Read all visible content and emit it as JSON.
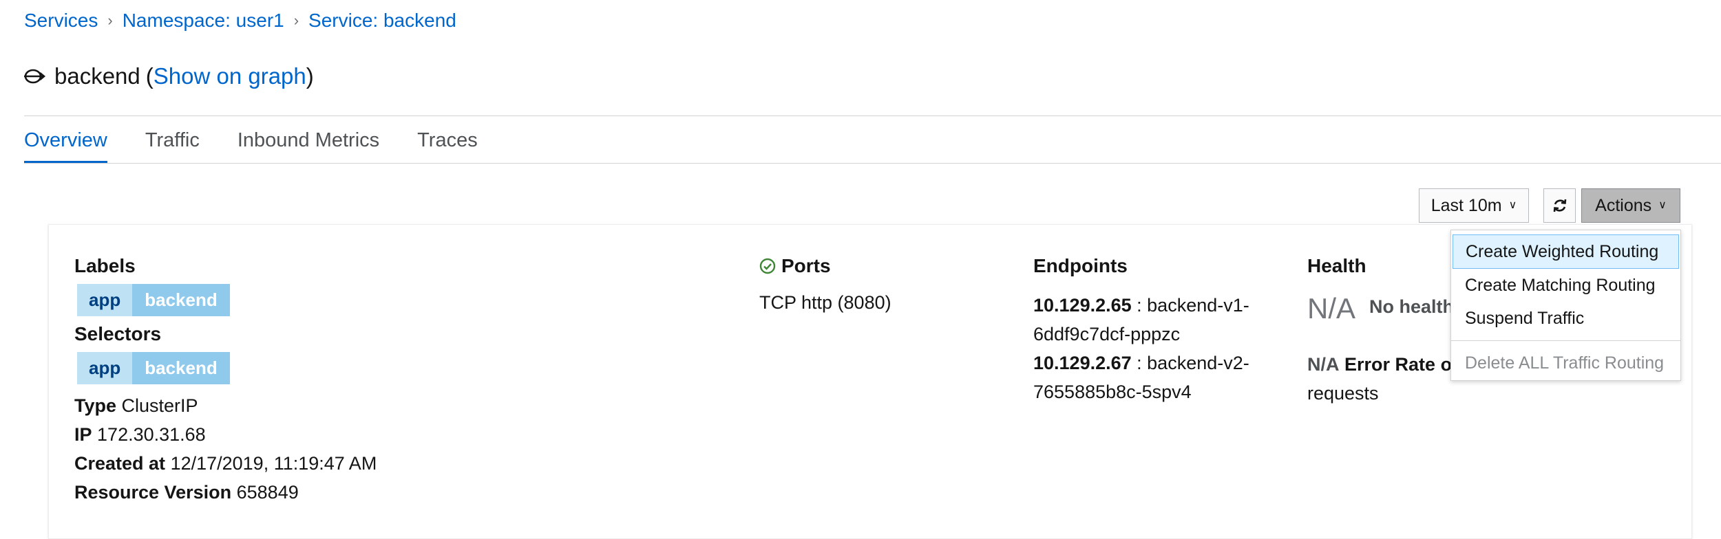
{
  "breadcrumb": [
    {
      "label": "Services"
    },
    {
      "label": "Namespace: user1"
    },
    {
      "label": "Service: backend"
    }
  ],
  "title": {
    "name": "backend",
    "open_paren": "(",
    "link": "Show on graph",
    "close_paren": ")"
  },
  "tabs": [
    {
      "label": "Overview",
      "active": true
    },
    {
      "label": "Traffic"
    },
    {
      "label": "Inbound Metrics"
    },
    {
      "label": "Traces"
    }
  ],
  "toolbar": {
    "time_range": "Last 10m",
    "refresh_icon": "refresh-icon",
    "actions_label": "Actions"
  },
  "actions_menu": [
    {
      "label": "Create Weighted Routing"
    },
    {
      "label": "Create Matching Routing"
    },
    {
      "label": "Suspend Traffic"
    },
    {
      "label": "Delete ALL Traffic Routing"
    }
  ],
  "details": {
    "labels_heading": "Labels",
    "labels": [
      {
        "key": "app",
        "value": "backend"
      }
    ],
    "selectors_heading": "Selectors",
    "selectors": [
      {
        "key": "app",
        "value": "backend"
      }
    ],
    "type": {
      "key": "Type",
      "value": "ClusterIP"
    },
    "ip": {
      "key": "IP",
      "value": "172.30.31.68"
    },
    "created": {
      "key": "Created at",
      "value": "12/17/2019, 11:19:47 AM"
    },
    "resource_version": {
      "key": "Resource Version",
      "value": "658849"
    }
  },
  "ports": {
    "heading": "Ports",
    "value": "TCP http (8080)"
  },
  "endpoints": {
    "heading": "Endpoints",
    "items": [
      {
        "ip": "10.129.2.65",
        "sep": " : ",
        "pod": "backend-v1-6ddf9c7dcf-pppzc"
      },
      {
        "ip": "10.129.2.67",
        "sep": " : ",
        "pod": "backend-v2-7655885b8c-5spv4"
      }
    ]
  },
  "health": {
    "heading": "Health",
    "na": "N/A",
    "no_health": "No health information",
    "error_na": "N/A",
    "error_label": "Error Rate over last 10m:",
    "error_value": "No requests"
  },
  "colors": {
    "link": "#0066cc",
    "label_key_bg": "#bee1f4",
    "label_value_bg": "#8fc9ec",
    "menu_highlight": "#def3ff",
    "ok_green": "#3e8635"
  }
}
